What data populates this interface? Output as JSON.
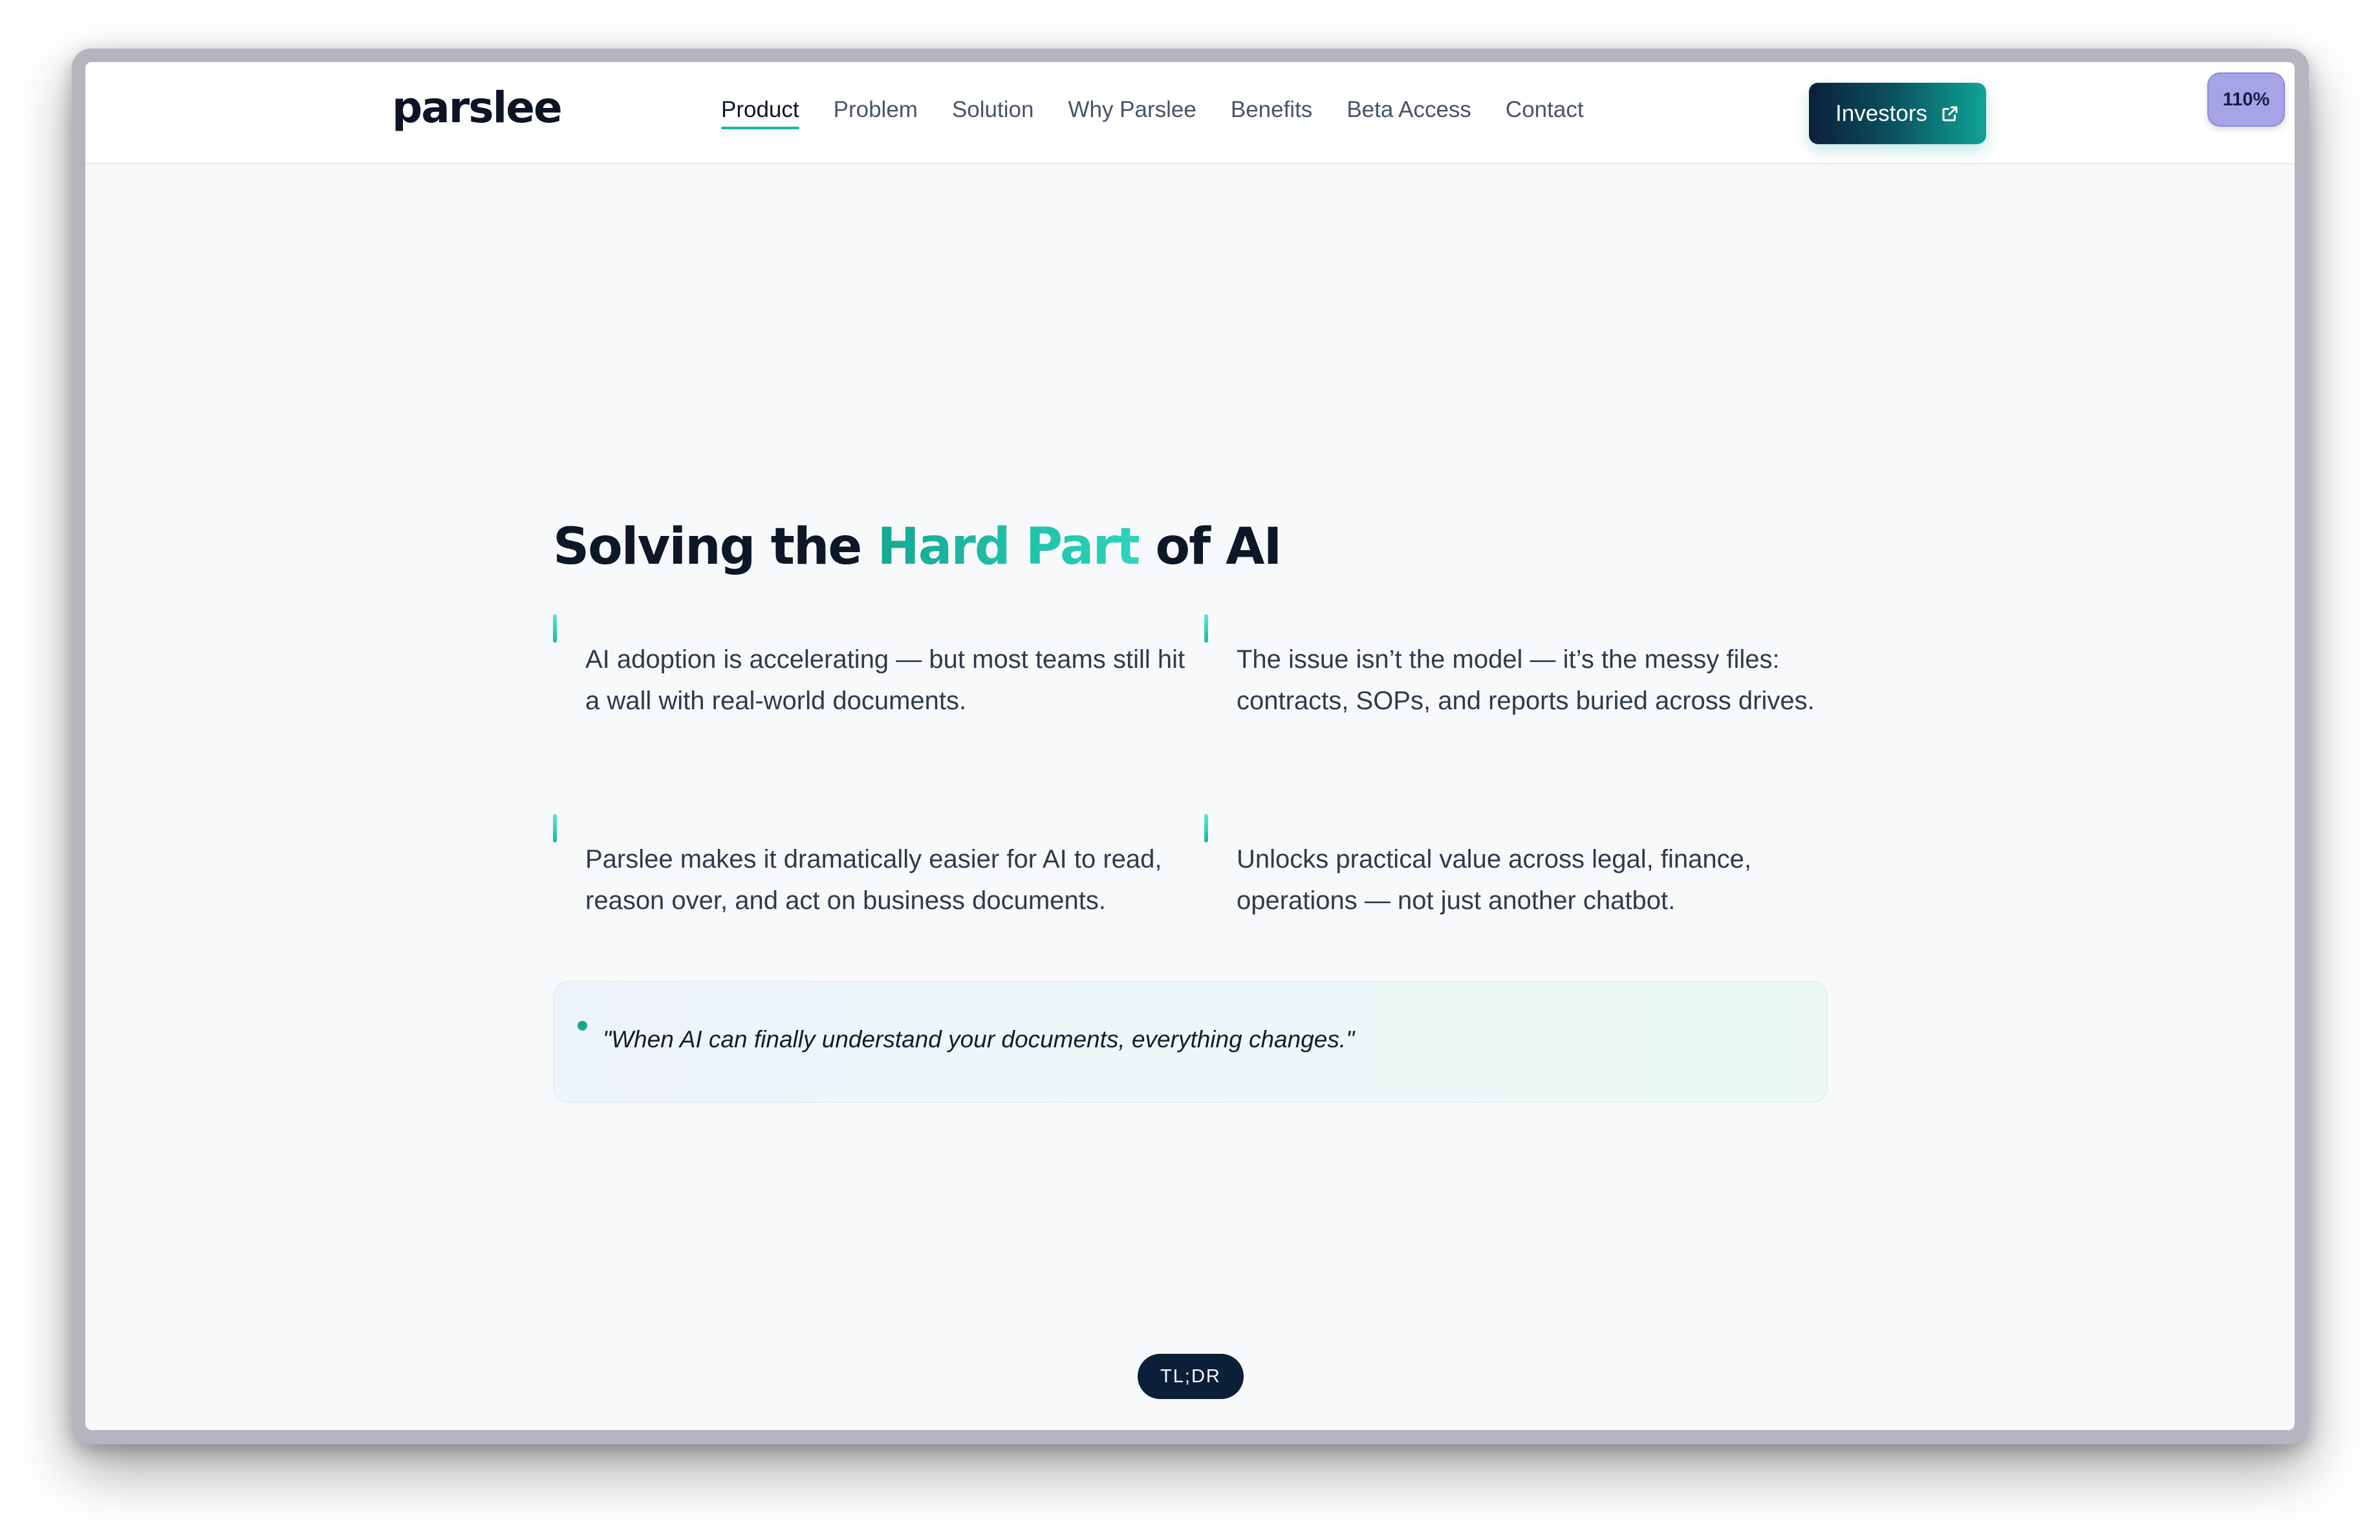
{
  "brand": {
    "logo": "parslee"
  },
  "nav": {
    "items": [
      {
        "label": "Product",
        "active": true
      },
      {
        "label": "Problem",
        "active": false
      },
      {
        "label": "Solution",
        "active": false
      },
      {
        "label": "Why Parslee",
        "active": false
      },
      {
        "label": "Benefits",
        "active": false
      },
      {
        "label": "Beta Access",
        "active": false
      },
      {
        "label": "Contact",
        "active": false
      }
    ],
    "cta": {
      "label": "Investors",
      "icon": "external-link-icon"
    }
  },
  "zoom": {
    "label": "110%"
  },
  "section": {
    "heading": {
      "before": "Solving the ",
      "accent": "Hard Part",
      "after": " of AI"
    },
    "points": [
      "AI adoption is accelerating — but most teams still hit a wall with real-world documents.",
      "The issue isn’t the model — it’s the messy files: contracts, SOPs, and reports buried across drives.",
      "Parslee makes it dramatically easier for AI to read, reason over, and act on business documents.",
      "Unlocks practical value across legal, finance, operations — not just another chatbot."
    ],
    "quote": "\"When AI can finally understand your documents, everything changes.\""
  },
  "tldr": {
    "label": "TL;DR"
  },
  "colors": {
    "accent": "#14b8a6",
    "navy": "#0c1f38",
    "zoom_badge": "#a6a3e6"
  }
}
